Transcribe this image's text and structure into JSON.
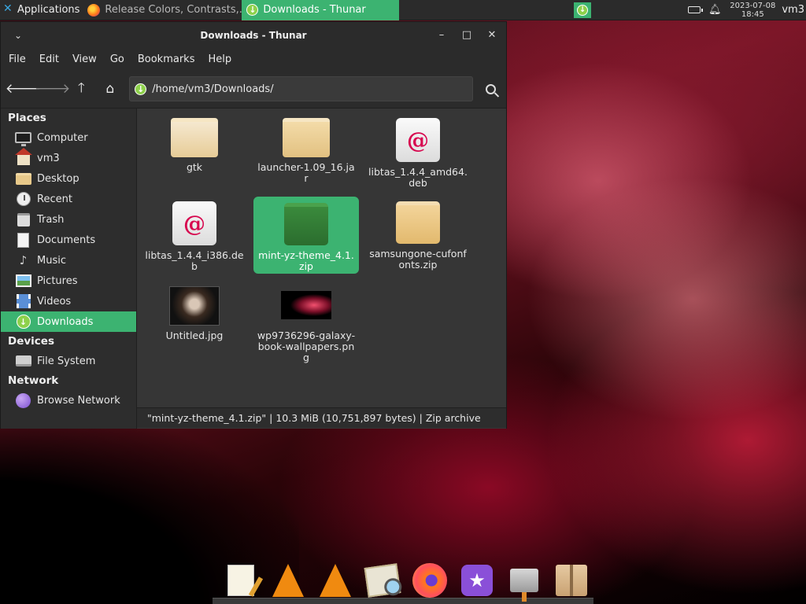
{
  "top_panel": {
    "applications_label": "Applications",
    "tasks": [
      {
        "label": "Release Colors, Contrasts,...",
        "icon": "firefox-icon",
        "active": false
      },
      {
        "label": "Downloads - Thunar",
        "icon": "downloads-icon",
        "active": true
      }
    ],
    "tray_downloads_glyph": "↓",
    "clock_date": "2023-07-08",
    "clock_time": "18:45",
    "user": "vm3"
  },
  "window": {
    "title": "Downloads - Thunar",
    "minimize_glyph": "–",
    "maximize_glyph": "□",
    "close_glyph": "✕",
    "menu_glyph": "⌄",
    "menubar": [
      "File",
      "Edit",
      "View",
      "Go",
      "Bookmarks",
      "Help"
    ],
    "toolbar": {
      "back_glyph": "🡐",
      "forward_glyph": "🡒",
      "up_glyph": "🡑",
      "home_glyph": "⌂",
      "location_path": "/home/vm3/Downloads/",
      "location_icon_glyph": "↓"
    },
    "sidebar": {
      "places_header": "Places",
      "places": [
        {
          "label": "Computer",
          "icon": "computer-icon"
        },
        {
          "label": "vm3",
          "icon": "home-icon"
        },
        {
          "label": "Desktop",
          "icon": "folder-icon"
        },
        {
          "label": "Recent",
          "icon": "recent-icon"
        },
        {
          "label": "Trash",
          "icon": "trash-icon"
        },
        {
          "label": "Documents",
          "icon": "documents-icon"
        },
        {
          "label": "Music",
          "icon": "music-icon"
        },
        {
          "label": "Pictures",
          "icon": "pictures-icon"
        },
        {
          "label": "Videos",
          "icon": "videos-icon"
        },
        {
          "label": "Downloads",
          "icon": "downloads-icon",
          "selected": true
        }
      ],
      "devices_header": "Devices",
      "devices": [
        {
          "label": "File System",
          "icon": "drive-icon"
        }
      ],
      "network_header": "Network",
      "network": [
        {
          "label": "Browse Network",
          "icon": "network-icon"
        }
      ]
    },
    "files": [
      {
        "name": "gtk",
        "type": "folder"
      },
      {
        "name": "launcher-1.09_16.jar",
        "type": "jar"
      },
      {
        "name": "libtas_1.4.4_amd64.deb",
        "type": "deb"
      },
      {
        "name": "libtas_1.4.4_i386.deb",
        "type": "deb"
      },
      {
        "name": "mint-yz-theme_4.1.zip",
        "type": "zip",
        "selected": true
      },
      {
        "name": "samsungone-cufonfonts.zip",
        "type": "zip"
      },
      {
        "name": "Untitled.jpg",
        "type": "image"
      },
      {
        "name": "wp9736296-galaxy-book-wallpapers.png",
        "type": "image"
      }
    ],
    "status": "\"mint-yz-theme_4.1.zip\"  |  10.3 MiB (10,751,897 bytes)  |  Zip archive",
    "deb_glyph": "@"
  },
  "dock": {
    "items": [
      "text-editor-icon",
      "vlc-icon",
      "vlc-icon",
      "image-viewer-icon",
      "firefox-icon",
      "favorites-icon",
      "network-manager-icon",
      "archive-manager-icon"
    ],
    "star_glyph": "★"
  },
  "colors": {
    "accent": "#3cb371",
    "panel_bg": "#2b2b2b",
    "content_bg": "#363636"
  }
}
